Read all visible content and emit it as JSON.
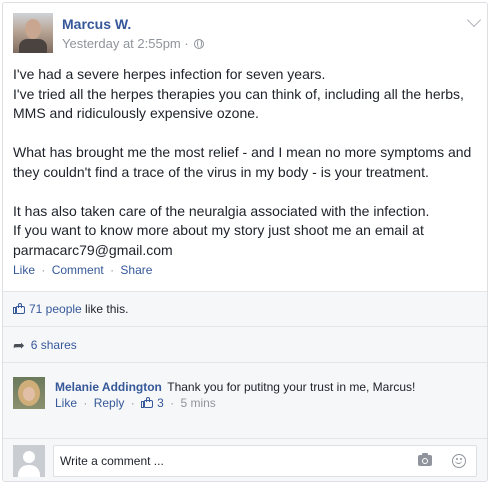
{
  "post": {
    "author": "Marcus W.",
    "timestamp": "Yesterday at 2:55pm ·",
    "audience_icon": "globe-icon",
    "text": "I've had a severe herpes infection for seven years.\nI've tried all the herpes therapies you can think of, including all the herbs,\nMMS and ridiculously expensive ozone.\n\nWhat has brought me the most relief - and I mean no more symptoms and\nthey couldn't find a trace of the virus in my body - is your treatment.\n\nIt has also taken care of the neuralgia associated with the infection.\nIf you want to know more about my story just shoot me an email at\nparmacarc79@gmail.com",
    "actions": {
      "like": "Like",
      "comment": "Comment",
      "share": "Share",
      "separator": "·"
    }
  },
  "reactions": {
    "likes_link": "71 people",
    "likes_suffix": " like this.",
    "shares": "6 shares"
  },
  "comments": [
    {
      "author": "Melanie Addington",
      "text": "Thank you for putitng your trust in me, Marcus!",
      "like": "Like",
      "reply": "Reply",
      "like_count": "3",
      "time": "5 mins"
    }
  ],
  "composer": {
    "placeholder": "Write a comment ...",
    "camera_icon": "camera-icon",
    "emoji_icon": "smiley-icon"
  },
  "colors": {
    "link": "#365899",
    "meta": "#90949c",
    "text": "#1d2129",
    "section_bg": "#f6f7f9"
  }
}
